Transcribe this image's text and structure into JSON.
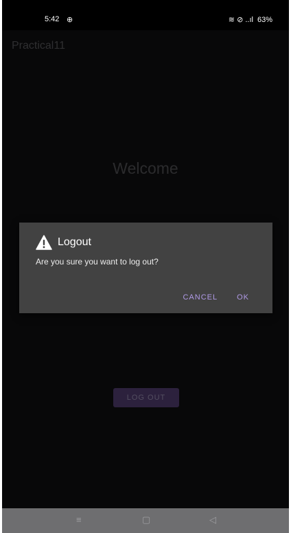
{
  "status_bar": {
    "time": "5:42",
    "left_icon": "⊕",
    "signal_text": "≋ ⊘ ..ıl",
    "battery": "63%"
  },
  "app_bar": {
    "title": "Practical11"
  },
  "main": {
    "welcome_text": "Welcome",
    "logout_button_label": "LOG OUT"
  },
  "dialog": {
    "icon": "warning-icon",
    "title": "Logout",
    "message": "Are you sure you want to log out?",
    "cancel_label": "CANCEL",
    "ok_label": "OK"
  },
  "nav_bar": {
    "menu_glyph": "≡",
    "home_glyph": "▢",
    "back_glyph": "◁"
  },
  "colors": {
    "background": "#0b0b0c",
    "dialog": "#424242",
    "accent": "#b09ae6",
    "button": "#3b2d52"
  }
}
